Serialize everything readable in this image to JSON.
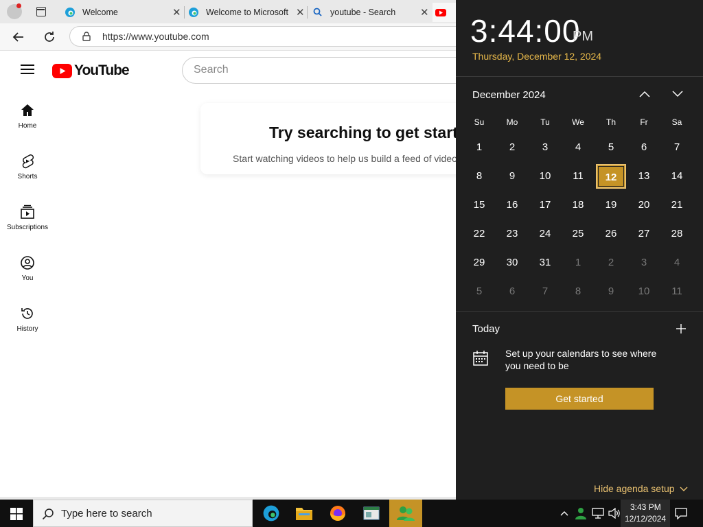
{
  "browser": {
    "tabs": [
      {
        "label": "Welcome"
      },
      {
        "label": "Welcome to Microsoft"
      },
      {
        "label": "youtube - Search"
      }
    ],
    "url": "https://www.youtube.com"
  },
  "youtube": {
    "logo_text": "YouTube",
    "search_placeholder": "Search",
    "nav": [
      {
        "label": "Home",
        "icon": "home-icon"
      },
      {
        "label": "Shorts",
        "icon": "shorts-icon"
      },
      {
        "label": "Subscriptions",
        "icon": "subscriptions-icon"
      },
      {
        "label": "You",
        "icon": "you-icon"
      },
      {
        "label": "History",
        "icon": "history-icon"
      }
    ],
    "empty_title": "Try searching to get started",
    "empty_sub": "Start watching videos to help us build a feed of videos you'll like"
  },
  "flyout": {
    "time": "3:44:00",
    "ampm": "PM",
    "date": "Thursday, December 12, 2024",
    "month_label": "December 2024",
    "weekdays": [
      "Su",
      "Mo",
      "Tu",
      "We",
      "Th",
      "Fr",
      "Sa"
    ],
    "weeks": [
      [
        "1",
        "2",
        "3",
        "4",
        "5",
        "6",
        "7"
      ],
      [
        "8",
        "9",
        "10",
        "11",
        "12",
        "13",
        "14"
      ],
      [
        "15",
        "16",
        "17",
        "18",
        "19",
        "20",
        "21"
      ],
      [
        "22",
        "23",
        "24",
        "25",
        "26",
        "27",
        "28"
      ],
      [
        "29",
        "30",
        "31",
        "1",
        "2",
        "3",
        "4"
      ],
      [
        "5",
        "6",
        "7",
        "8",
        "9",
        "10",
        "11"
      ]
    ],
    "selected_day": "12",
    "today_label": "Today",
    "setup_text": "Set up your calendars to see where you need to be",
    "get_started_label": "Get started",
    "hide_agenda_label": "Hide agenda setup",
    "accent_color": "#c59326"
  },
  "taskbar": {
    "search_placeholder": "Type here to search",
    "clock_time": "3:43 PM",
    "clock_date": "12/12/2024"
  }
}
